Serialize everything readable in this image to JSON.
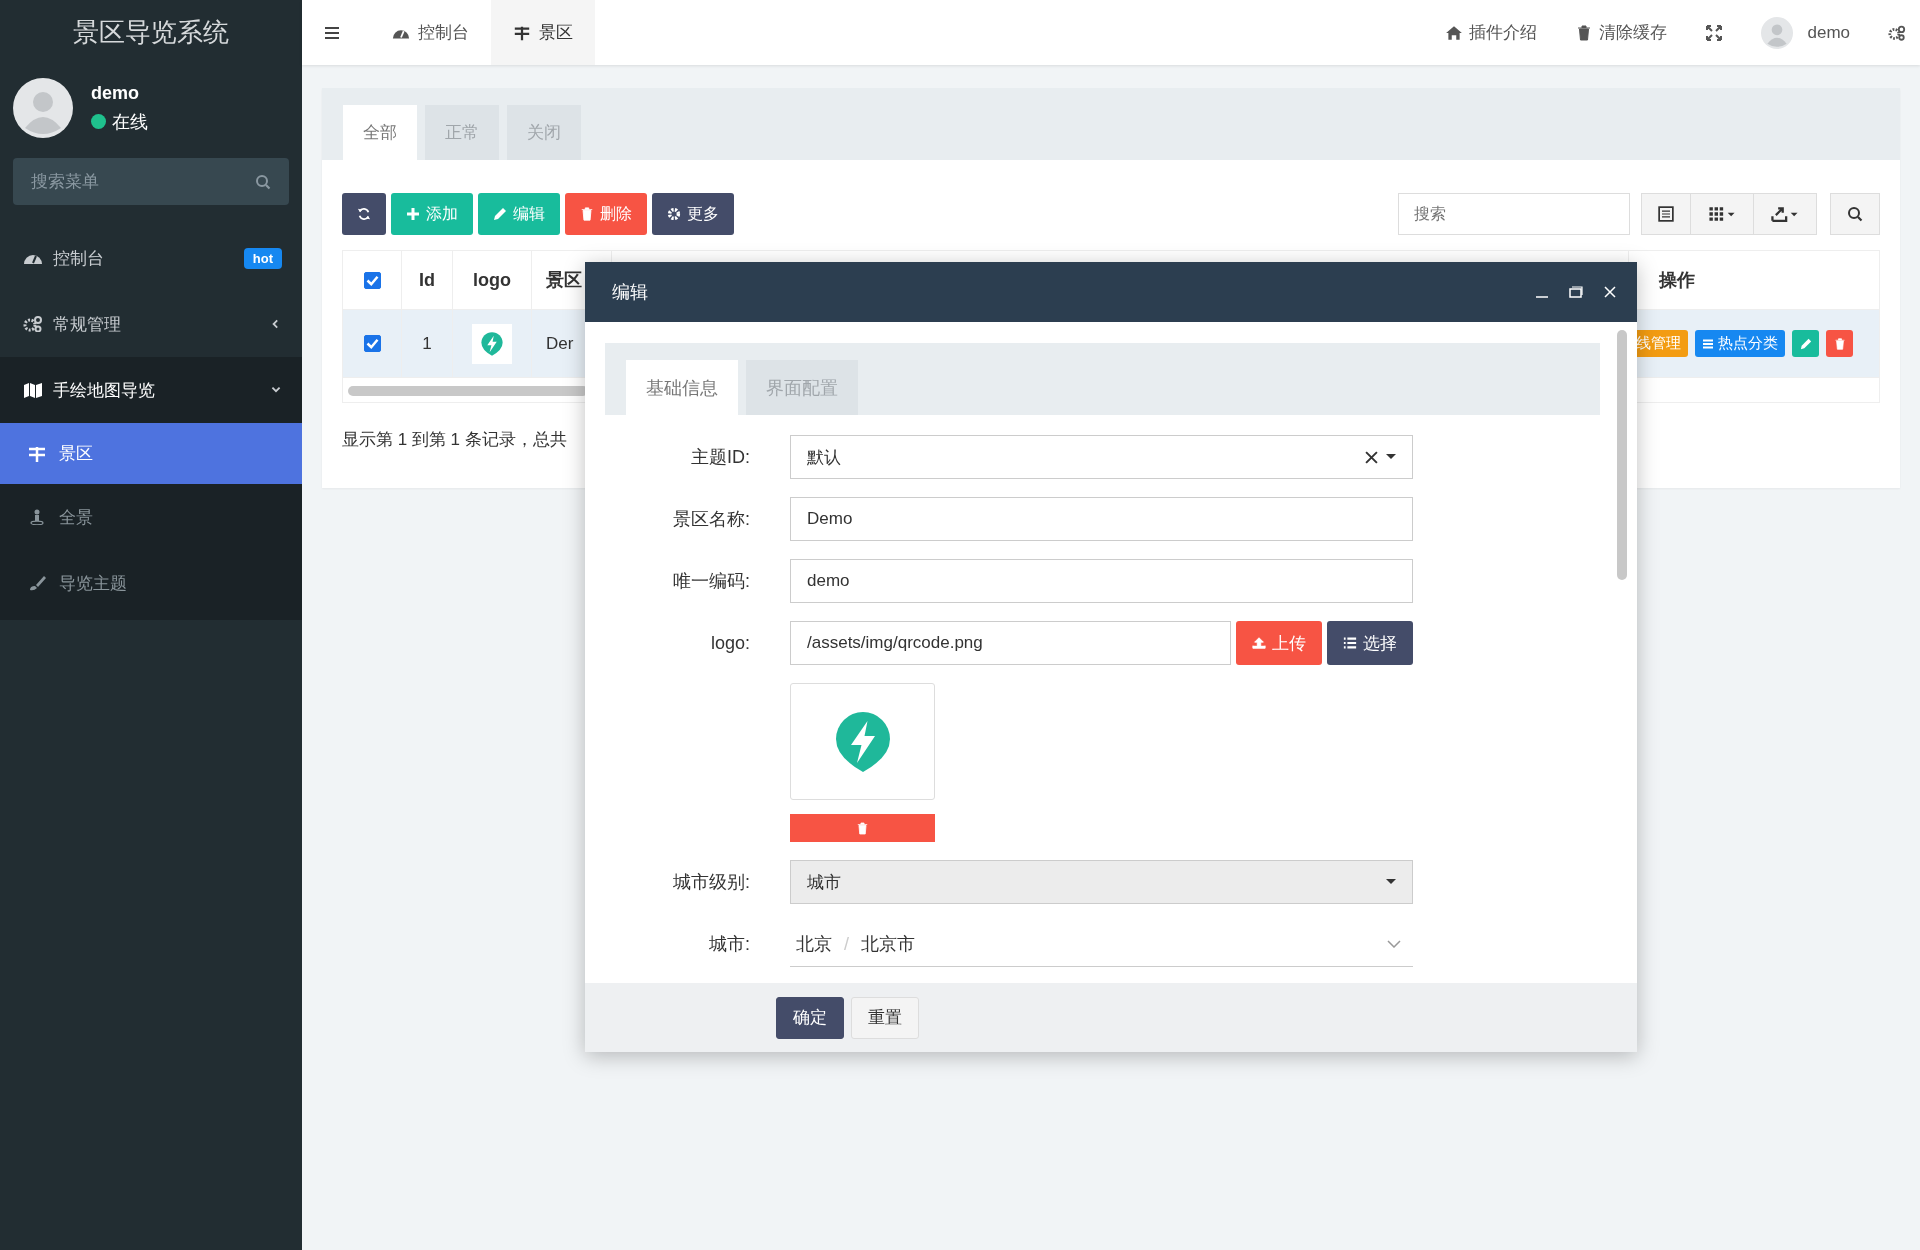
{
  "sidebar": {
    "title": "景区导览系统",
    "user": {
      "name": "demo",
      "status": "在线",
      "online": true
    },
    "search": {
      "placeholder": "搜索菜单"
    },
    "menu": [
      {
        "label": "控制台",
        "badge": "hot",
        "expanded": false,
        "selected": false
      },
      {
        "label": "常规管理",
        "expanded": false,
        "selected": false,
        "has_children": true
      },
      {
        "label": "手绘地图导览",
        "expanded": true,
        "selected": false,
        "has_children": true,
        "children": [
          {
            "label": "景区",
            "selected": true
          },
          {
            "label": "全景",
            "selected": false
          },
          {
            "label": "导览主题",
            "selected": false
          }
        ]
      }
    ]
  },
  "topbar": {
    "tabs": [
      {
        "label": "控制台",
        "selected": false
      },
      {
        "label": "景区",
        "selected": true
      }
    ],
    "links": [
      "插件介绍",
      "清除缓存"
    ],
    "user": "demo"
  },
  "content": {
    "tabs": [
      {
        "label": "全部",
        "selected": true
      },
      {
        "label": "正常",
        "selected": false
      },
      {
        "label": "关闭",
        "selected": false
      }
    ],
    "toolbar": [
      {
        "color": "#444c69"
      },
      {
        "label": "添加",
        "color": "#18bc9c"
      },
      {
        "label": "编辑",
        "color": "#18bc9c"
      },
      {
        "label": "删除",
        "color": "#f75444"
      },
      {
        "label": "更多",
        "color": "#444c69"
      }
    ],
    "search": {
      "placeholder": "搜索"
    },
    "table": {
      "columns": [
        "Id",
        "logo",
        "景区"
      ],
      "all_checked": true,
      "actions_column": "操作",
      "rows": [
        {
          "checked": true,
          "id": "1",
          "name": "Der",
          "actions": [
            {
              "kind": "text",
              "label": "线管理",
              "color": "#f39c12"
            },
            {
              "kind": "text",
              "label": "热点分类",
              "color": "#1688f1"
            },
            {
              "kind": "edit",
              "color": "#18bc9c"
            },
            {
              "kind": "delete",
              "color": "#f75444"
            }
          ]
        }
      ]
    },
    "pagination": "显示第 1 到第 1 条记录，总共"
  },
  "dialog": {
    "title": "编辑",
    "tabs": [
      {
        "label": "基础信息",
        "selected": true
      },
      {
        "label": "界面配置",
        "selected": false
      }
    ],
    "fields": [
      {
        "kind": "select",
        "label": "主题ID:",
        "value": "默认",
        "clearable": true,
        "filled": false
      },
      {
        "kind": "input",
        "label": "景区名称:",
        "value": "Demo"
      },
      {
        "kind": "input",
        "label": "唯一编码:",
        "value": "demo"
      },
      {
        "kind": "upload",
        "label": "logo:",
        "value": "/assets/img/qrcode.png",
        "buttons": [
          "上传",
          "选择"
        ]
      },
      {
        "kind": "select",
        "label": "城市级别:",
        "value": "城市",
        "clearable": false,
        "filled": true
      },
      {
        "kind": "cascader",
        "label": "城市:",
        "parts": [
          "北京",
          "北京市"
        ],
        "separator": "/"
      }
    ],
    "buttons": [
      {
        "label": "确定",
        "primary": true
      },
      {
        "label": "重置",
        "primary": false
      }
    ]
  }
}
